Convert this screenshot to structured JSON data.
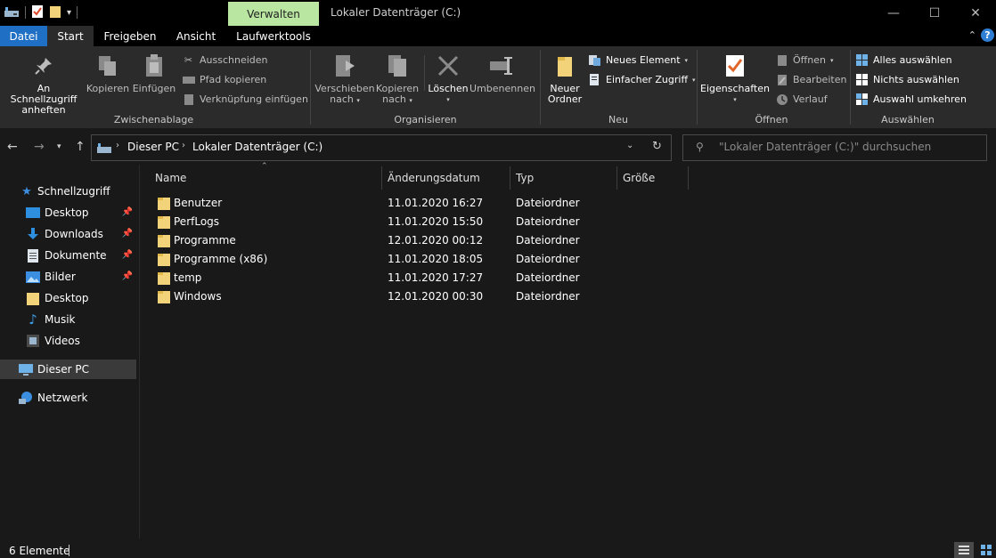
{
  "titlebar": {
    "context_tab": "Verwalten",
    "title": "Lokaler Datenträger (C:)",
    "minimize_icon": "minimize-icon",
    "maximize_icon": "maximize-icon",
    "close_icon": "close-icon"
  },
  "tabs": {
    "datei": "Datei",
    "start": "Start",
    "freigeben": "Freigeben",
    "ansicht": "Ansicht",
    "laufwerktools": "Laufwerktools"
  },
  "ribbon": {
    "groups": {
      "clipboard": "Zwischenablage",
      "organize": "Organisieren",
      "new": "Neu",
      "open": "Öffnen",
      "select": "Auswählen"
    },
    "pin_line1": "An Schnellzugriff",
    "pin_line2": "anheften",
    "copy": "Kopieren",
    "paste": "Einfügen",
    "cut": "Ausschneiden",
    "copy_path": "Pfad kopieren",
    "paste_shortcut": "Verknüpfung einfügen",
    "move_line1": "Verschieben",
    "move_line2": "nach",
    "copyto_line1": "Kopieren",
    "copyto_line2": "nach",
    "delete": "Löschen",
    "rename": "Umbenennen",
    "new_folder_line1": "Neuer",
    "new_folder_line2": "Ordner",
    "new_item": "Neues Element",
    "easy_access": "Einfacher Zugriff",
    "properties": "Eigenschaften",
    "open": "Öffnen",
    "edit": "Bearbeiten",
    "history": "Verlauf",
    "select_all": "Alles auswählen",
    "select_none": "Nichts auswählen",
    "invert_selection": "Auswahl umkehren"
  },
  "address": {
    "crumb1": "Dieser PC",
    "crumb2": "Lokaler Datenträger (C:)",
    "search_placeholder": "\"Lokaler Datenträger (C:)\" durchsuchen"
  },
  "sidebar": {
    "items": [
      {
        "label": "Schnellzugriff"
      },
      {
        "label": "Desktop"
      },
      {
        "label": "Downloads"
      },
      {
        "label": "Dokumente"
      },
      {
        "label": "Bilder"
      },
      {
        "label": "Desktop"
      },
      {
        "label": "Musik"
      },
      {
        "label": "Videos"
      },
      {
        "label": "Dieser PC"
      },
      {
        "label": "Netzwerk"
      }
    ]
  },
  "columns": {
    "name": "Name",
    "date": "Änderungsdatum",
    "type": "Typ",
    "size": "Größe"
  },
  "files": [
    {
      "name": "Benutzer",
      "date": "11.01.2020 16:27",
      "type": "Dateiordner"
    },
    {
      "name": "PerfLogs",
      "date": "11.01.2020 15:50",
      "type": "Dateiordner"
    },
    {
      "name": "Programme",
      "date": "12.01.2020 00:12",
      "type": "Dateiordner"
    },
    {
      "name": "Programme (x86)",
      "date": "11.01.2020 18:05",
      "type": "Dateiordner"
    },
    {
      "name": "temp",
      "date": "11.01.2020 17:27",
      "type": "Dateiordner"
    },
    {
      "name": "Windows",
      "date": "12.01.2020 00:30",
      "type": "Dateiordner"
    }
  ],
  "status": {
    "count": "6 Elemente"
  },
  "colors": {
    "accent": "#1f6fc5",
    "context_tab": "#b9e6a0",
    "folder": "#f3d37a"
  }
}
